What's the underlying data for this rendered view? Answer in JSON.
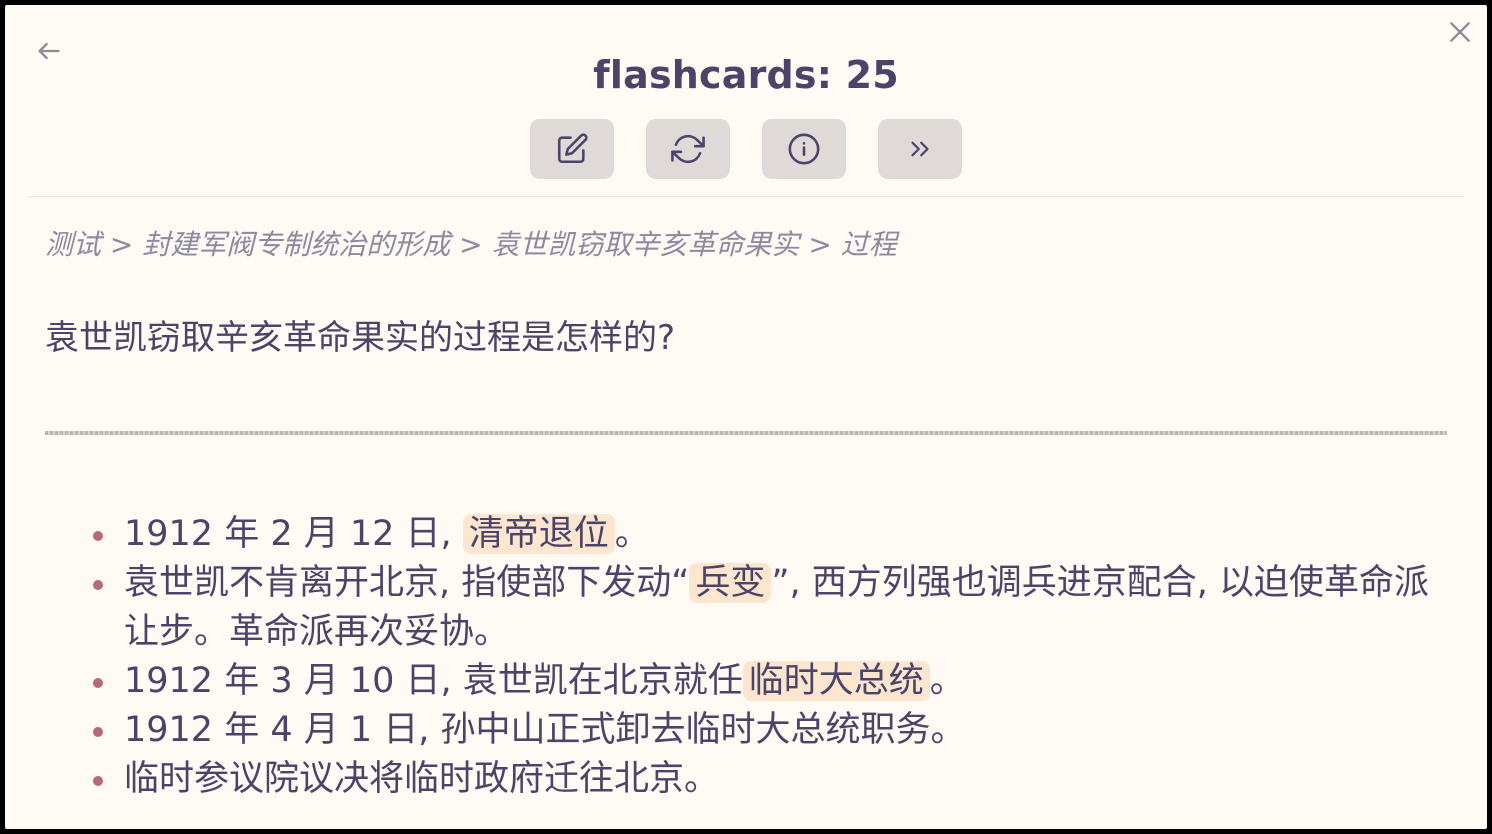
{
  "header": {
    "title": "flashcards: 25",
    "back_icon": "arrow-left-icon",
    "close_icon": "close-icon"
  },
  "toolbar": {
    "buttons": [
      {
        "icon": "edit-icon"
      },
      {
        "icon": "refresh-icon"
      },
      {
        "icon": "info-icon"
      },
      {
        "icon": "skip-forward-icon"
      }
    ]
  },
  "breadcrumb": {
    "text": "测试 > 封建军阀专制统治的形成 > 袁世凯窃取辛亥革命果实 > 过程"
  },
  "card": {
    "question": "袁世凯窃取辛亥革命果实的过程是怎样的?",
    "answer": [
      {
        "before": "1912 年 2 月 12 日, ",
        "highlight": "清帝退位",
        "after": "。"
      },
      {
        "before": "袁世凯不肯离开北京, 指使部下发动“",
        "highlight": "兵变",
        "after": "”, 西方列强也调兵进京配合, 以迫使革命派让步。革命派再次妥协。"
      },
      {
        "before": "1912 年 3 月 10 日, 袁世凯在北京就任",
        "highlight": "临时大总统",
        "after": "。"
      },
      {
        "before": "1912 年 4 月 1 日, 孙中山正式卸去临时大总统职务。",
        "highlight": "",
        "after": ""
      },
      {
        "before": "临时参议院议决将临时政府迁往北京。",
        "highlight": "",
        "after": ""
      }
    ]
  },
  "colors": {
    "background": "#fffaf3",
    "text": "#4b4469",
    "highlight": "#fce6cf",
    "bullet": "#b46a7c",
    "button": "#dfd9d8"
  }
}
